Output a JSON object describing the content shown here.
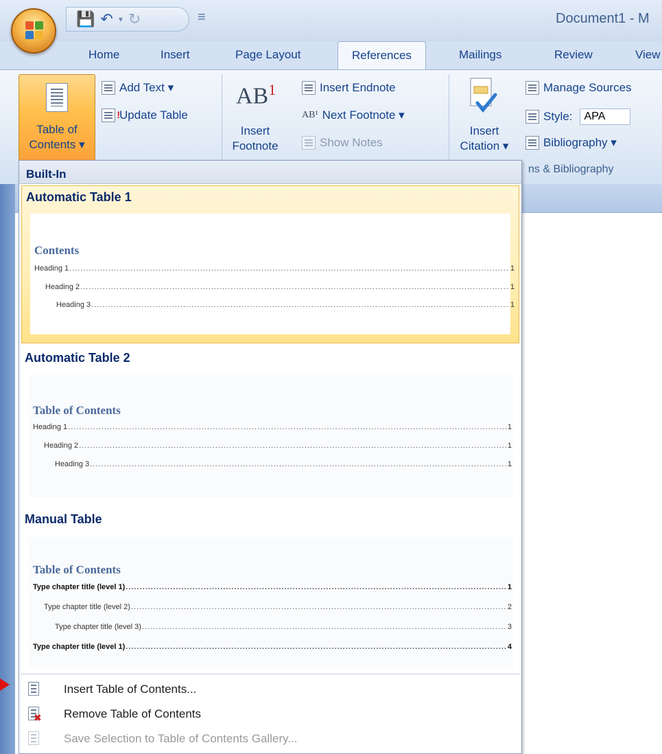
{
  "window": {
    "title": "Document1 - M"
  },
  "quick_access": {
    "save_icon": "save-icon",
    "undo_icon": "undo-icon",
    "redo_icon": "redo-icon",
    "customize_icon": "customize-qat-icon"
  },
  "tabs": [
    {
      "label": "Home"
    },
    {
      "label": "Insert"
    },
    {
      "label": "Page Layout"
    },
    {
      "label": "References",
      "active": true
    },
    {
      "label": "Mailings"
    },
    {
      "label": "Review"
    },
    {
      "label": "View"
    }
  ],
  "ribbon": {
    "toc_button": {
      "line1": "Table of",
      "line2": "Contents ▾"
    },
    "add_text": "Add Text ▾",
    "update_table": "Update Table",
    "ab_text": "AB",
    "ab_sup": "1",
    "insert_footnote": {
      "line1": "Insert",
      "line2": "Footnote"
    },
    "insert_endnote": "Insert Endnote",
    "next_footnote": "Next Footnote ▾",
    "show_notes": "Show Notes",
    "insert_citation": {
      "line1": "Insert",
      "line2": "Citation ▾"
    },
    "manage_sources": "Manage Sources",
    "style_label": "Style:",
    "style_value": "APA",
    "bibliography": "Bibliography ▾",
    "citations_group_label": "ns & Bibliography"
  },
  "gallery": {
    "builtin_header": "Built-In",
    "entries": [
      {
        "title": "Automatic Table 1",
        "heading": "Contents",
        "lines": [
          {
            "text": "Heading 1",
            "page": "1"
          },
          {
            "text": "Heading 2",
            "page": "1"
          },
          {
            "text": "Heading 3",
            "page": "1"
          }
        ]
      },
      {
        "title": "Automatic Table 2",
        "heading": "Table of Contents",
        "lines": [
          {
            "text": "Heading 1",
            "page": "1"
          },
          {
            "text": "Heading 2",
            "page": "1"
          },
          {
            "text": "Heading 3",
            "page": "1"
          }
        ]
      },
      {
        "title": "Manual Table",
        "heading": "Table of Contents",
        "lines": [
          {
            "text": "Type chapter title (level 1)",
            "page": "1"
          },
          {
            "text": "Type chapter title (level 2)",
            "page": "2"
          },
          {
            "text": "Type chapter title (level 3)",
            "page": "3"
          },
          {
            "text": "Type chapter title (level 1)",
            "page": "4"
          }
        ]
      }
    ],
    "menu": [
      {
        "label": "Insert Table of Contents...",
        "icon": "insert-toc-icon",
        "enabled": true
      },
      {
        "label": "Remove Table of Contents",
        "icon": "remove-toc-icon",
        "enabled": true
      },
      {
        "label": "Save Selection to Table of Contents Gallery...",
        "icon": "save-selection-icon",
        "enabled": false
      }
    ]
  },
  "dots": "..................................................................................................................................................................................................................................................................................................................................................................................."
}
